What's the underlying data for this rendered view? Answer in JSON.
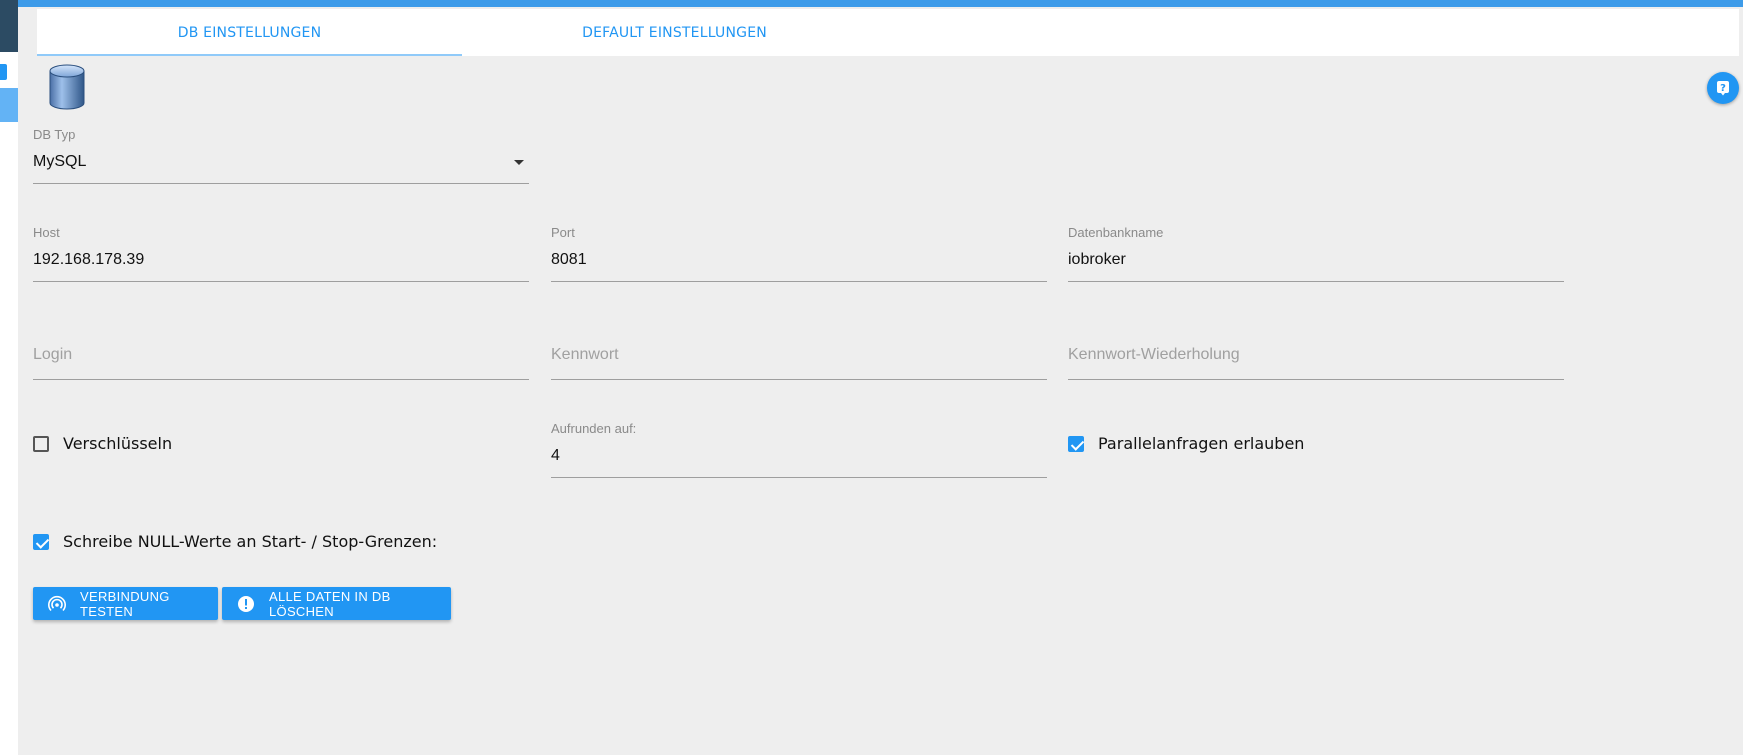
{
  "tabs": [
    {
      "label": "DB EINSTELLUNGEN",
      "active": true
    },
    {
      "label": "DEFAULT EINSTELLUNGEN",
      "active": false
    }
  ],
  "icons": {
    "database": "database-icon",
    "help": "help-icon",
    "test_connection": "wifi-tethering-icon",
    "delete_all": "alert-circle-icon"
  },
  "db_type": {
    "label": "DB Typ",
    "value": "MySQL"
  },
  "host": {
    "label": "Host",
    "value": "192.168.178.39"
  },
  "port": {
    "label": "Port",
    "value": "8081"
  },
  "db_name": {
    "label": "Datenbankname",
    "value": "iobroker"
  },
  "login": {
    "placeholder": "Login",
    "value": ""
  },
  "password": {
    "placeholder": "Kennwort",
    "value": ""
  },
  "password_repeat": {
    "placeholder": "Kennwort-Wiederholung",
    "value": ""
  },
  "encrypt": {
    "label": "Verschlüsseln",
    "checked": false
  },
  "round": {
    "label": "Aufrunden auf:",
    "value": "4"
  },
  "parallel": {
    "label": "Parallelanfragen erlauben",
    "checked": true
  },
  "write_nulls": {
    "label": "Schreibe NULL-Werte an Start- / Stop-Grenzen:",
    "checked": true
  },
  "buttons": {
    "test_connection": "VERBINDUNG TESTEN",
    "delete_all": "ALLE DATEN IN DB LÖSCHEN"
  },
  "colors": {
    "accent": "#2196f3",
    "background": "#eeeeee",
    "topbar": "#3d9be9"
  }
}
